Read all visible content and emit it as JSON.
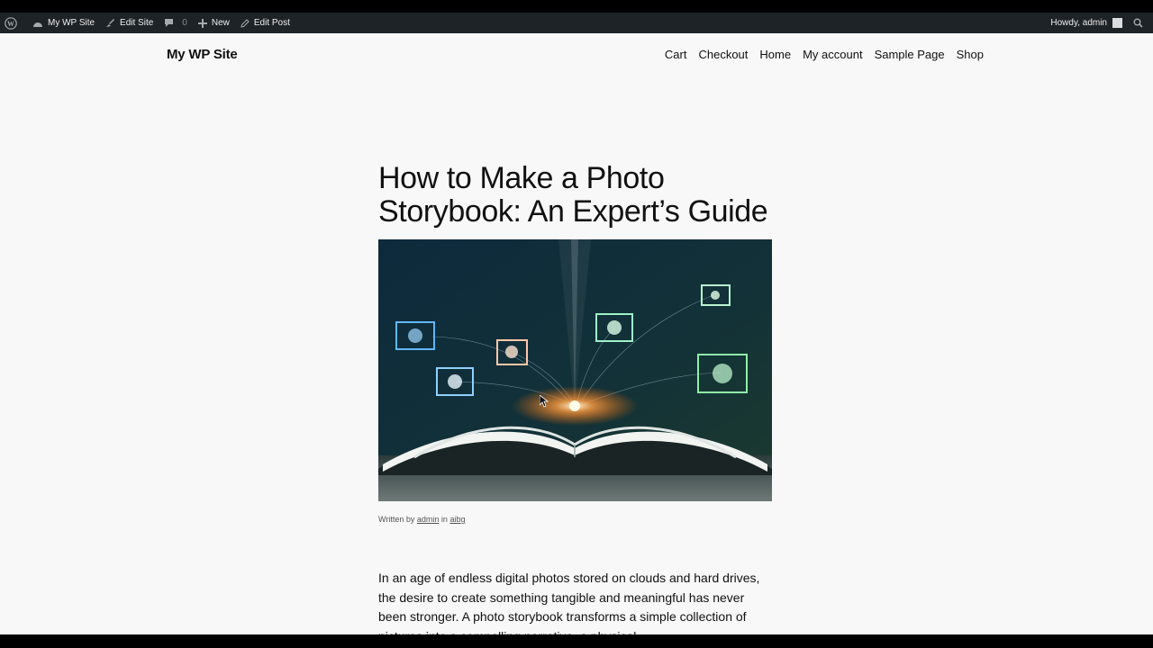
{
  "admin_bar": {
    "wp_logo_icon": "wordpress-icon",
    "site_name": "My WP Site",
    "edit_site": "Edit Site",
    "comments_count": "0",
    "new_label": "New",
    "edit_post": "Edit Post",
    "howdy": "Howdy, admin"
  },
  "header": {
    "site_title": "My WP Site",
    "nav": [
      "Cart",
      "Checkout",
      "Home",
      "My account",
      "Sample Page",
      "Shop"
    ]
  },
  "post": {
    "title": "How to Make a Photo Storybook: An Expert’s Guide",
    "byline_prefix": "Written by",
    "author": "admin",
    "byline_in": "in",
    "category": "aibg",
    "intro": "In an age of endless digital photos stored on clouds and hard drives, the desire to create something tangible and meaningful has never been stronger. A photo storybook transforms a simple collection of pictures into a compelling narrative, a physical"
  },
  "colors": {
    "admin_bar_bg": "#1d2327",
    "page_bg": "#f9f8f8",
    "text": "#111111"
  }
}
